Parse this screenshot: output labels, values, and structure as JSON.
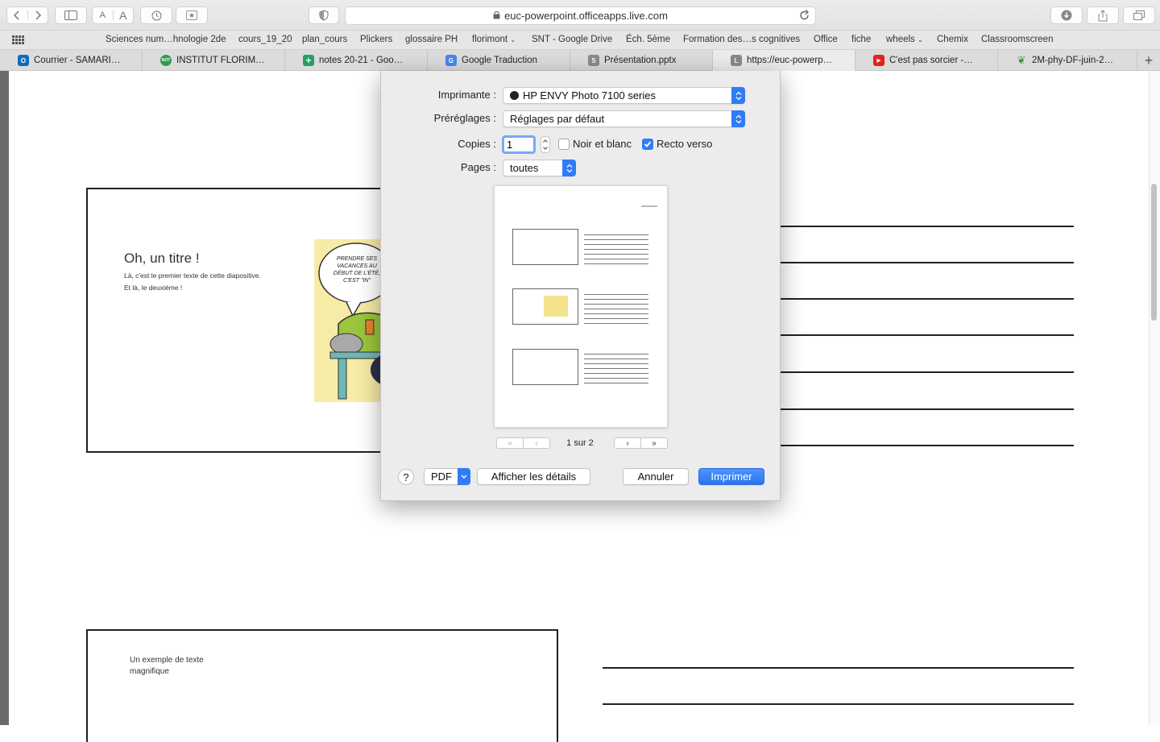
{
  "browser": {
    "url": "euc-powerpoint.officeapps.live.com",
    "bookmarks": [
      "Sciences num…hnologie 2de",
      "cours_19_20",
      "plan_cours",
      "Plickers",
      "glossaire PH",
      "florimont",
      "SNT - Google Drive",
      "Éch. 5ème",
      "Formation des…s cognitives",
      "Office",
      "fiche",
      "wheels",
      "Chemix",
      "Classroomscreen"
    ],
    "tabs": [
      {
        "label": "Courrier - SAMARI…",
        "icon_color": "#0f6cbd",
        "icon": "outlook-icon",
        "glyph": "O"
      },
      {
        "label": "INSTITUT FLORIM…",
        "icon_color": "#2e9b4f",
        "icon": "institut-icon",
        "glyph": "NOT"
      },
      {
        "label": "notes 20-21 - Goo…",
        "icon_color": "#1ea362",
        "icon": "sheets-icon",
        "glyph": "+"
      },
      {
        "label": "Google Traduction",
        "icon_color": "#4a86f0",
        "icon": "translate-icon",
        "glyph": "G"
      },
      {
        "label": "Présentation.pptx",
        "icon_color": "#8a8a8a",
        "icon": "s-letter-icon",
        "glyph": "S"
      },
      {
        "label": "https://euc-powerp…",
        "icon_color": "#8a8a8a",
        "icon": "l-letter-icon",
        "glyph": "L"
      },
      {
        "label": "C'est pas sorcier -…",
        "icon_color": "#e62117",
        "icon": "youtube-icon",
        "glyph": "▶"
      },
      {
        "label": "2M-phy-DF-juin-2…",
        "icon_color": "#3f9b3f",
        "icon": "leaf-icon",
        "glyph": "❦"
      }
    ]
  },
  "slides": {
    "slide1": {
      "title": "Oh, un titre !",
      "line1": "Là, c'est le premier texte de cette diapositive.",
      "line2": "Et là, le deuxième !",
      "cartoon_bubble": "PRENDRE SES VACANCES AU DÉBUT DE L'ÉTÉ, C'EST \"IN\""
    },
    "slide2": {
      "line1": "Un exemple de texte",
      "line2": "magnifique"
    }
  },
  "print_dialog": {
    "printer_label": "Imprimante :",
    "printer_value": "HP ENVY Photo 7100 series",
    "presets_label": "Préréglages :",
    "presets_value": "Réglages par défaut",
    "copies_label": "Copies :",
    "copies_value": "1",
    "bw_label": "Noir et blanc",
    "bw_checked": false,
    "duplex_label": "Recto verso",
    "duplex_checked": true,
    "pages_label": "Pages :",
    "pages_value": "toutes",
    "page_indicator": "1 sur 2",
    "help": "?",
    "pdf": "PDF",
    "details": "Afficher les détails",
    "cancel": "Annuler",
    "print": "Imprimer",
    "accent": "#2f7cf6"
  }
}
